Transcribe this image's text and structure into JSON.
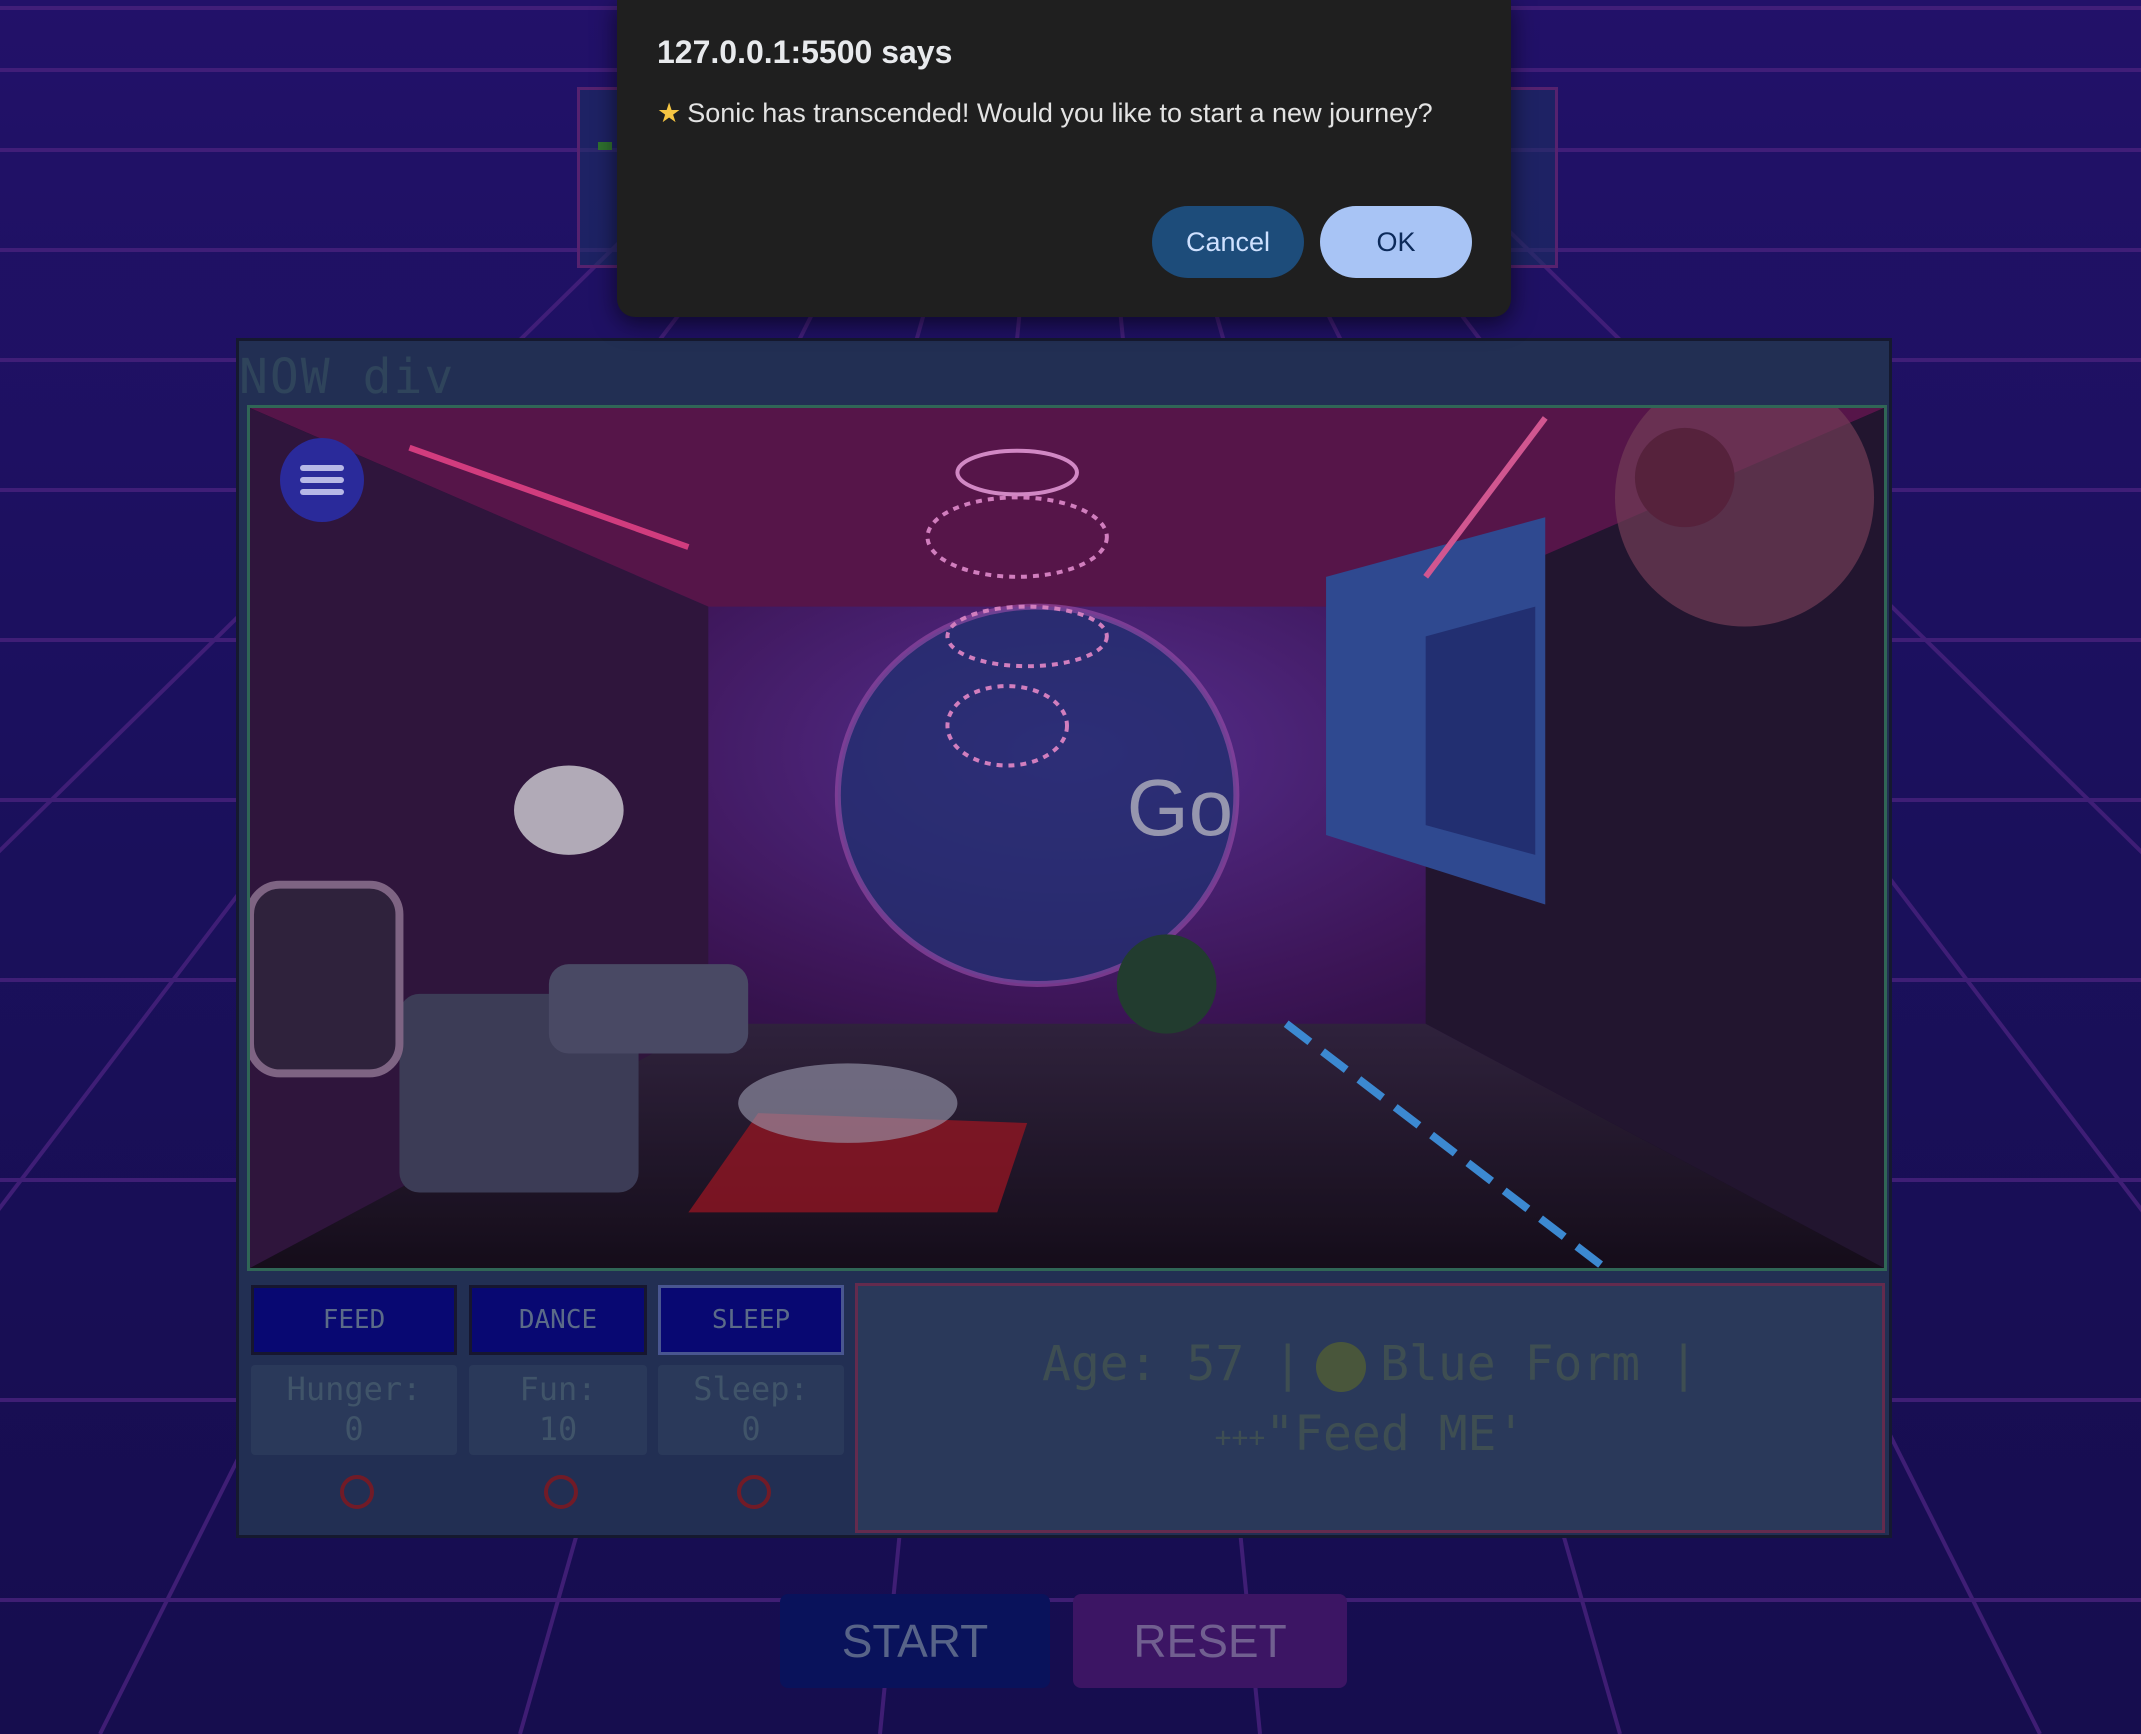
{
  "dialog": {
    "title": "127.0.0.1:5500 says",
    "icon": "star-icon",
    "message": "Sonic has transcended! Would you like to start a new journey?",
    "cancel_label": "Cancel",
    "ok_label": "OK"
  },
  "game": {
    "header_text": "NOW div",
    "actions": [
      {
        "label": "FEED"
      },
      {
        "label": "DANCE"
      },
      {
        "label": "SLEEP"
      }
    ],
    "stats": [
      {
        "label": "Hunger:",
        "value": "0"
      },
      {
        "label": "Fun:",
        "value": "10"
      },
      {
        "label": "Sleep:",
        "value": "0"
      }
    ],
    "status": {
      "age_label": "Age: 57 |",
      "form_label": "Blue Form |",
      "message_prefix": "+++",
      "message": "\"Feed ME'"
    }
  },
  "footer": {
    "start_label": "START",
    "reset_label": "RESET"
  },
  "colors": {
    "background": "#221170",
    "grid": "#5a2a9a",
    "dialog_bg": "#1f1f1f",
    "ok_button": "#a8c4f5",
    "cancel_button": "#1d4c7a"
  }
}
